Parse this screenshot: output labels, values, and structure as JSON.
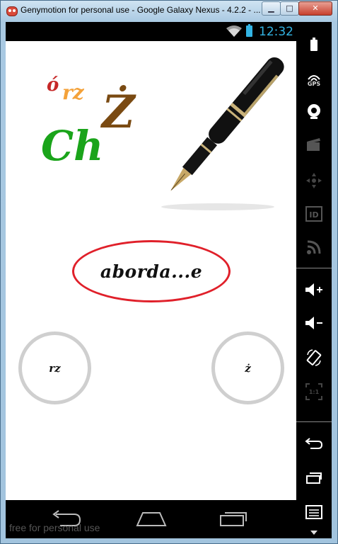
{
  "window": {
    "title": "Genymotion for personal use - Google Galaxy Nexus - 4.2.2 - ...",
    "min_label": "▁",
    "max_label": "□",
    "close_label": "✕"
  },
  "statusbar": {
    "time": "12:32",
    "accent_color": "#33b5e5"
  },
  "app": {
    "logo": {
      "letters": [
        "ó",
        "rz",
        "Ż",
        "Ch"
      ]
    },
    "word": "aborda...e",
    "choices": [
      "rz",
      "ż"
    ],
    "oval_color": "#e0202a",
    "choice_ring_color": "#cfcfcf"
  },
  "navbar": {
    "buttons": [
      "back-icon",
      "home-icon",
      "recents-icon"
    ],
    "watermark": "free for personal use"
  },
  "sidepanel": {
    "buttons": [
      "battery-icon",
      "gps-icon",
      "camera-icon",
      "video-icon",
      "dpad-icon",
      "id-icon",
      "rss-icon",
      "volume-up-icon",
      "volume-down-icon",
      "rotate-icon",
      "scale-icon",
      "back-icon",
      "recents-icon",
      "menu-icon"
    ],
    "gps_label": "GPS",
    "id_label": "ID",
    "scale_label": "1:1"
  }
}
